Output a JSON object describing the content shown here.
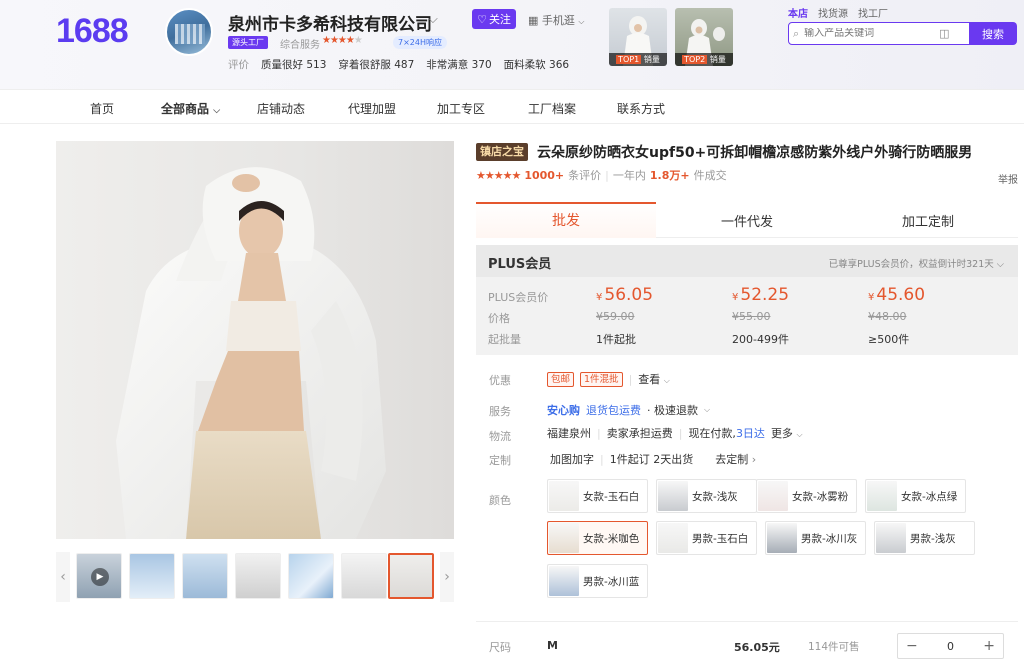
{
  "header": {
    "logo": "1688",
    "shop_name": "泉州市卡多希科技有限公司",
    "follow_label": "关注",
    "phone_label": "手机逛",
    "factory_badge": "源头工厂",
    "service_label": "综合服务",
    "service_rating": 4,
    "response_badge": "7×24H响应",
    "reviews": {
      "label": "评价",
      "items": [
        {
          "text": "质量很好",
          "count": "513"
        },
        {
          "text": "穿着很舒服",
          "count": "487"
        },
        {
          "text": "非常满意",
          "count": "370"
        },
        {
          "text": "面料柔软",
          "count": "366"
        }
      ]
    },
    "top_thumbs": [
      {
        "rank": "TOP1",
        "label": "销量"
      },
      {
        "rank": "TOP2",
        "label": "销量"
      }
    ],
    "search": {
      "tabs": [
        "本店",
        "找货源",
        "找工厂"
      ],
      "placeholder": "输入产品关键词",
      "button": "搜索"
    }
  },
  "nav": {
    "items": [
      "首页",
      "全部商品",
      "店铺动态",
      "代理加盟",
      "加工专区",
      "工厂档案",
      "联系方式"
    ]
  },
  "product": {
    "brand_tag": "镇店之宝",
    "title": "云朵原纱防晒衣女upf50+可拆卸帽檐凉感防紫外线户外骑行防晒服男",
    "rating_stars": 5,
    "review_count": "1000+",
    "review_suffix": "条评价",
    "deals_prefix": "一年内",
    "deals_count": "1.8万+",
    "deals_suffix": "件成交",
    "report_label": "举报"
  },
  "tabs": [
    "批发",
    "一件代发",
    "加工定制"
  ],
  "pricing": {
    "title": "PLUS会员",
    "note": "已尊享PLUS会员价，权益倒计时321天",
    "row_labels": [
      "PLUS会员价",
      "价格",
      "起批量"
    ],
    "currency": "¥",
    "tiers": [
      {
        "plus_price": "56.05",
        "price": "¥59.00",
        "moq": "1件起批"
      },
      {
        "plus_price": "52.25",
        "price": "¥55.00",
        "moq": "200-499件"
      },
      {
        "plus_price": "45.60",
        "price": "¥48.00",
        "moq": "≥500件"
      }
    ]
  },
  "info": {
    "promo_label": "优惠",
    "promo_tags": [
      "包邮",
      "1件混批"
    ],
    "promo_more": "查看",
    "service_label": "服务",
    "service_brand": "安心购",
    "service_items": [
      "退货包运费",
      "· 极速退款"
    ],
    "logistics_label": "物流",
    "logistics_items": [
      "福建泉州",
      "卖家承担运费",
      "现在付款,"
    ],
    "logistics_eta": "3日达",
    "logistics_more": "更多",
    "custom_label": "定制",
    "custom_items": [
      "加图加字",
      "1件起订 2天出货",
      "去定制"
    ]
  },
  "colors": {
    "label": "颜色",
    "options": [
      {
        "name": "女款-玉石白",
        "swatch": "#ecebe8"
      },
      {
        "name": "女款-浅灰",
        "swatch": "#c8cbcf"
      },
      {
        "name": "女款-冰雾粉",
        "swatch": "#efe5e4"
      },
      {
        "name": "女款-冰点绿",
        "swatch": "#dde5e0"
      },
      {
        "name": "女款-米咖色",
        "swatch": "#e7ddd0"
      },
      {
        "name": "男款-玉石白",
        "swatch": "#e9e9e7"
      },
      {
        "name": "男款-冰川灰",
        "swatch": "#a6adb6"
      },
      {
        "name": "男款-浅灰",
        "swatch": "#c9ccd0"
      },
      {
        "name": "男款-冰川蓝",
        "swatch": "#aec1d9"
      }
    ],
    "selected_index": 4
  },
  "size_row": {
    "label": "尺码",
    "value": "M",
    "price": "56.05元",
    "stock": "114件可售",
    "qty": "0",
    "minus": "−",
    "plus": "+"
  },
  "colors_theme": {
    "accent": "#e4572e",
    "brand": "#6a39f0"
  }
}
